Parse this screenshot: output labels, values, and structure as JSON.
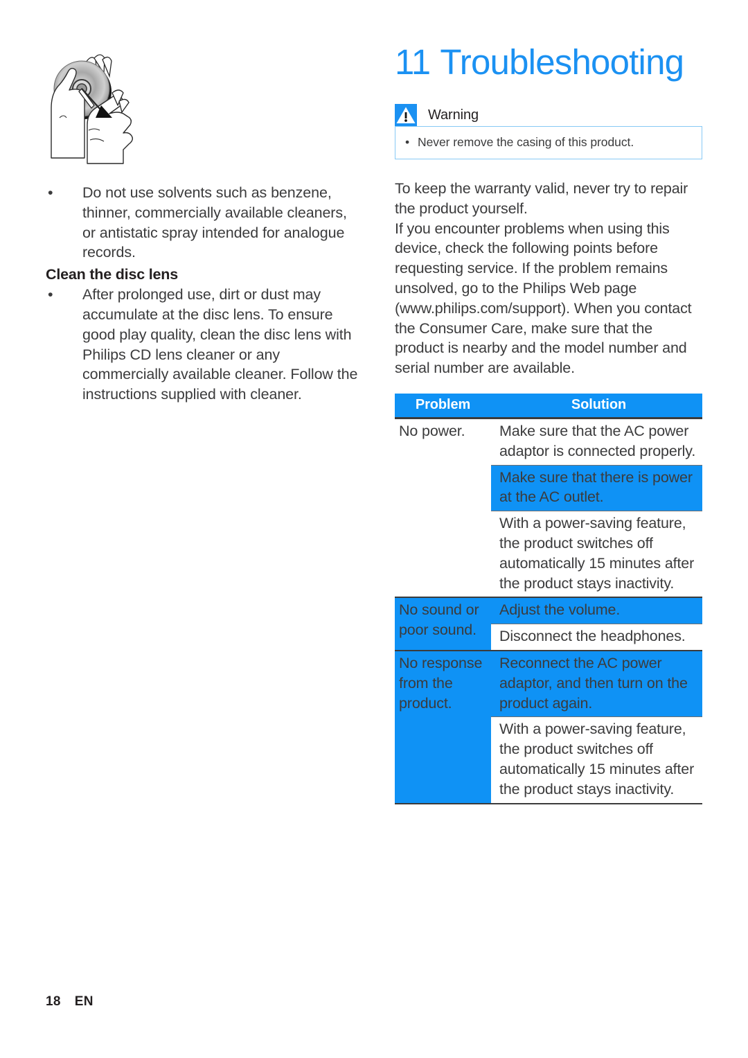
{
  "colors": {
    "brand_blue": "#1b91f2",
    "highlight_blue": "#0f92f5",
    "note_border": "#87c9f5",
    "body_text": "#3b3b3c"
  },
  "left_column": {
    "illustration_name": "hands-cleaning-disc-illustration",
    "bullets": [
      "Do not use solvents such as benzene, thinner, commercially available cleaners, or antistatic spray intended for analogue records."
    ],
    "subheading": "Clean the disc lens",
    "bullets_after_subheading": [
      "After prolonged use, dirt or dust may accumulate at the disc lens. To ensure good play quality, clean the disc lens with Philips CD lens cleaner or any commercially available cleaner. Follow the instructions supplied with cleaner."
    ],
    "bullet_glyph": "•"
  },
  "right_column": {
    "chapter_number": "11",
    "chapter_title": "Troubleshooting",
    "note": {
      "icon": "warning-triangle-icon",
      "title": "Warning",
      "bullet_glyph": "•",
      "items": [
        "Never remove the casing of this product."
      ]
    },
    "intro_paragraphs": [
      "To keep the warranty valid, never try to repair the product yourself.",
      "If you encounter problems when using this device, check the following points before requesting service. If the problem remains unsolved, go to the Philips Web page (www.philips.com/support). When you contact the Consumer Care, make sure that the product is nearby and the model number and serial number are available."
    ],
    "table": {
      "headers": [
        "Problem",
        "Solution"
      ],
      "rows": [
        {
          "problem": "No power.",
          "problem_highlighted": false,
          "solutions": [
            {
              "text": "Make sure that the AC power adaptor is connected properly.",
              "highlighted": false
            },
            {
              "text": "Make sure that there is power at the AC outlet.",
              "highlighted": true
            },
            {
              "text": "With a power-saving feature, the product switches off automatically 15 minutes after the product stays inactivity.",
              "highlighted": false
            }
          ]
        },
        {
          "problem": "No sound or poor sound.",
          "problem_highlighted": true,
          "solutions": [
            {
              "text": "Adjust the volume.",
              "highlighted": true
            },
            {
              "text": "Disconnect the headphones.",
              "highlighted": false
            }
          ]
        },
        {
          "problem": "No response from the product.",
          "problem_highlighted": true,
          "solutions": [
            {
              "text": "Reconnect the AC power adaptor, and then turn on the product again.",
              "highlighted": true
            },
            {
              "text": "With a power-saving feature, the product switches off automatically 15 minutes after the product stays inactivity.",
              "highlighted": false
            }
          ]
        }
      ]
    }
  },
  "footer": {
    "page_number": "18",
    "language": "EN"
  }
}
